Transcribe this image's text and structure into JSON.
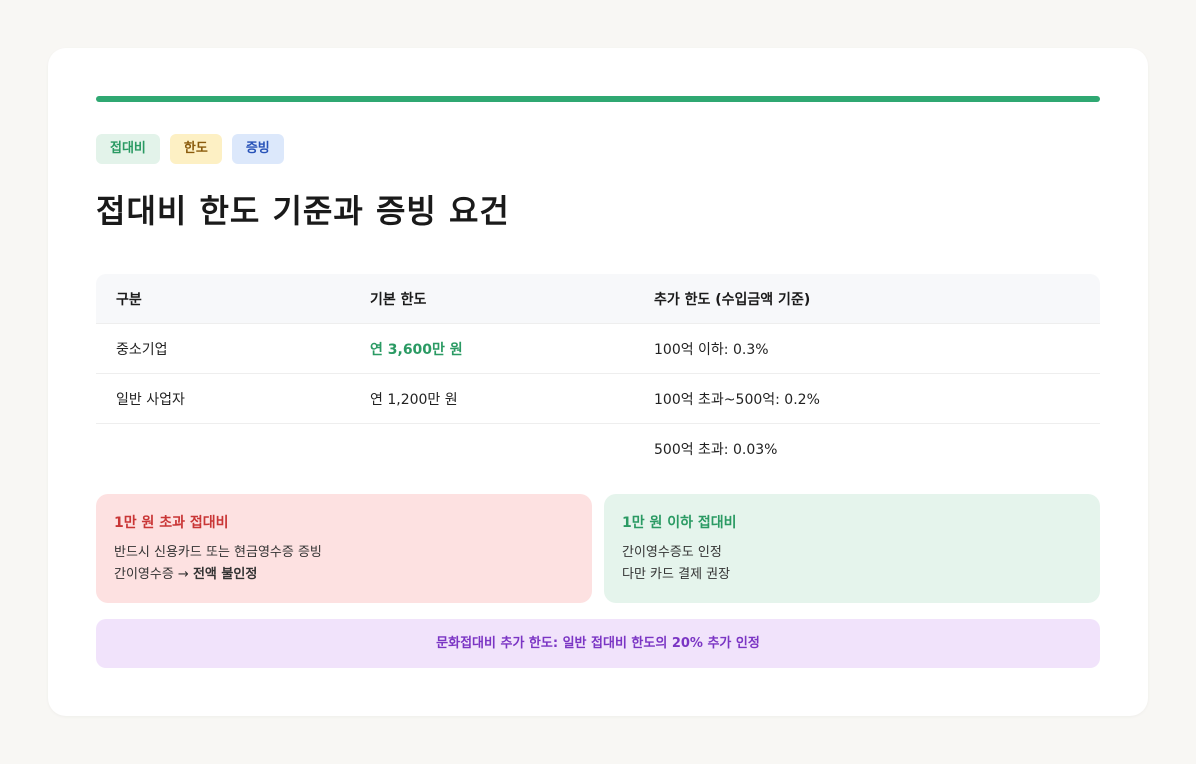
{
  "tags": [
    {
      "label": "접대비"
    },
    {
      "label": "한도"
    },
    {
      "label": "증빙"
    }
  ],
  "title": "접대비 한도 기준과 증빙 요건",
  "table": {
    "headers": [
      "구분",
      "기본 한도",
      "추가 한도 (수입금액 기준)"
    ],
    "rows": [
      {
        "category": "중소기업",
        "base": "연 3,600만 원",
        "extra": "100억 이하: 0.3%"
      },
      {
        "category": "일반 사업자",
        "base": "연 1,200만 원",
        "extra": "100억 초과~500억: 0.2%"
      },
      {
        "category": "",
        "base": "",
        "extra": "500억 초과: 0.03%"
      }
    ]
  },
  "box_over": {
    "title": "1만 원 초과 접대비",
    "line1": "반드시 신용카드 또는 현금영수증 증빙",
    "line2_prefix": "간이영수증 → ",
    "line2_strong": "전액 불인정"
  },
  "box_under": {
    "title": "1만 원 이하 접대비",
    "line1": "간이영수증도 인정",
    "line2": "다만 카드 결제 권장"
  },
  "note": "문화접대비 추가 한도: 일반 접대비 한도의 20% 추가 인정",
  "colors": {
    "accent": "#2fa872",
    "red_bg": "#fde1e1",
    "green_bg": "#e5f4ec",
    "purple_bg": "#f1e3fb"
  }
}
